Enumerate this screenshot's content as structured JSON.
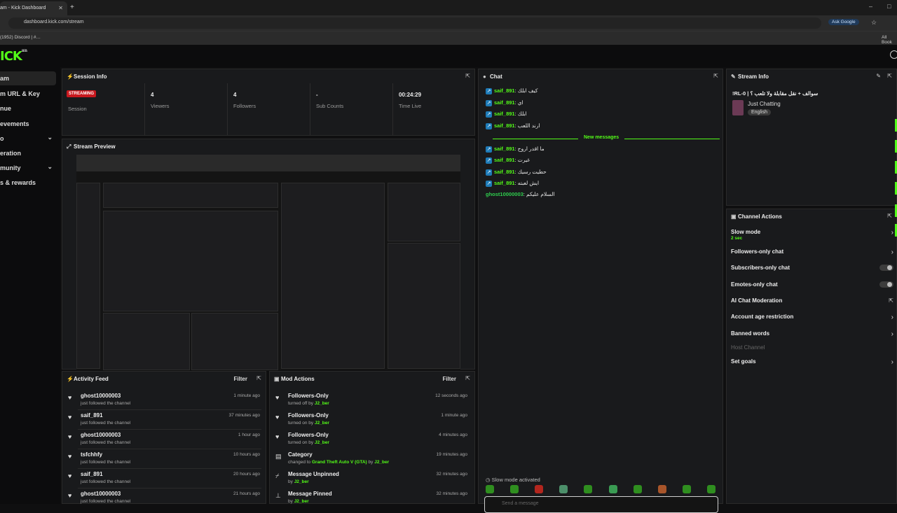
{
  "browser": {
    "tab_title": "am - Kick Dashboard",
    "url": "dashboard.kick.com/stream",
    "ask_google": "Ask Google",
    "bookmark_discord": "(1952) Discord | #…",
    "all_bookmarks": "All Book"
  },
  "app": {
    "logo": "ICK",
    "logo_badge": "BETA"
  },
  "sidebar": {
    "items": [
      {
        "label": "am"
      },
      {
        "label": "m URL & Key"
      },
      {
        "label": "nue"
      },
      {
        "label": "evements"
      },
      {
        "label": "o"
      },
      {
        "label": "eration"
      },
      {
        "label": "munity"
      },
      {
        "label": "s & rewards"
      }
    ]
  },
  "session": {
    "title": "Session Info",
    "badge": "STREAMING",
    "session_label": "Session",
    "viewers": "4",
    "viewers_label": "Viewers",
    "followers": "4",
    "followers_label": "Followers",
    "subs": "-",
    "subs_label": "Sub Counts",
    "time": "00:24:29",
    "time_label": "Time Live"
  },
  "preview": {
    "title": "Stream Preview"
  },
  "activity": {
    "title": "Activity Feed",
    "filter": "Filter",
    "items": [
      {
        "name": "ghost10000003",
        "sub": "just followed the channel",
        "time": "1 minute ago"
      },
      {
        "name": "saif_891",
        "sub": "just followed the channel",
        "time": "37 minutes ago"
      },
      {
        "name": "ghost10000003",
        "sub": "just followed the channel",
        "time": "1 hour ago"
      },
      {
        "name": "tsfchhfy",
        "sub": "just followed the channel",
        "time": "10 hours ago"
      },
      {
        "name": "saif_891",
        "sub": "just followed the channel",
        "time": "20 hours ago"
      },
      {
        "name": "ghost10000003",
        "sub": "just followed the channel",
        "time": "21 hours ago"
      }
    ]
  },
  "mod": {
    "title": "Mod Actions",
    "filter": "Filter",
    "items": [
      {
        "name": "Followers-Only",
        "pre": "turned off by",
        "by": "J2_ber",
        "time": "12 seconds ago"
      },
      {
        "name": "Followers-Only",
        "pre": "turned on by",
        "by": "J2_ber",
        "time": "1 minute ago"
      },
      {
        "name": "Followers-Only",
        "pre": "turned on by",
        "by": "J2_ber",
        "time": "4 minutes ago"
      },
      {
        "name": "Category",
        "pre": "changed to",
        "cat": "Grand Theft Auto V (GTA)",
        "mid": "by",
        "by": "J2_ber",
        "time": "19 minutes ago"
      },
      {
        "name": "Message Unpinned",
        "pre": "by",
        "by": "J2_ber",
        "time": "32 minutes ago"
      },
      {
        "name": "Message Pinned",
        "pre": "by",
        "by": "J2_ber",
        "time": "32 minutes ago"
      }
    ]
  },
  "chat": {
    "title": "Chat",
    "messages": [
      {
        "user": "saif_891",
        "text": "كيف ابلك"
      },
      {
        "user": "saif_891",
        "text": "اي"
      },
      {
        "user": "saif_891",
        "text": "ابلك"
      },
      {
        "user": "saif_891",
        "text": "ارند اللعب"
      },
      {
        "user": "saif_891",
        "text": "ما اقدر اروح"
      },
      {
        "user": "saif_891",
        "text": "غيرت"
      },
      {
        "user": "saif_891",
        "text": "حطيت رسيك"
      },
      {
        "user": "saif_891",
        "text": "ايش لعبته"
      },
      {
        "user": "ghost10000003",
        "text": "السلام عليكم"
      }
    ],
    "new_messages": "New messages",
    "slow_mode": "Slow mode activated",
    "placeholder": "Send a message"
  },
  "stream_info": {
    "title": "Stream Info",
    "stream_title": "!RL-0 | سوالف + نقل مقابلة ولا تلعب ؟",
    "category": "Just Chatting",
    "language": "English"
  },
  "channel_actions": {
    "title": "Channel Actions",
    "slow_mode": "Slow mode",
    "slow_value": "2 sec",
    "followers_only": "Followers-only chat",
    "subscribers_only": "Subscribers-only chat",
    "emotes_only": "Emotes-only chat",
    "ai_mod": "AI Chat Moderation",
    "age": "Account age restriction",
    "banned": "Banned words",
    "host": "Host Channel",
    "goals": "Set goals"
  },
  "colors": {
    "accent": "#53fc18",
    "live": "#c8181e",
    "panel": "#191a1c"
  }
}
